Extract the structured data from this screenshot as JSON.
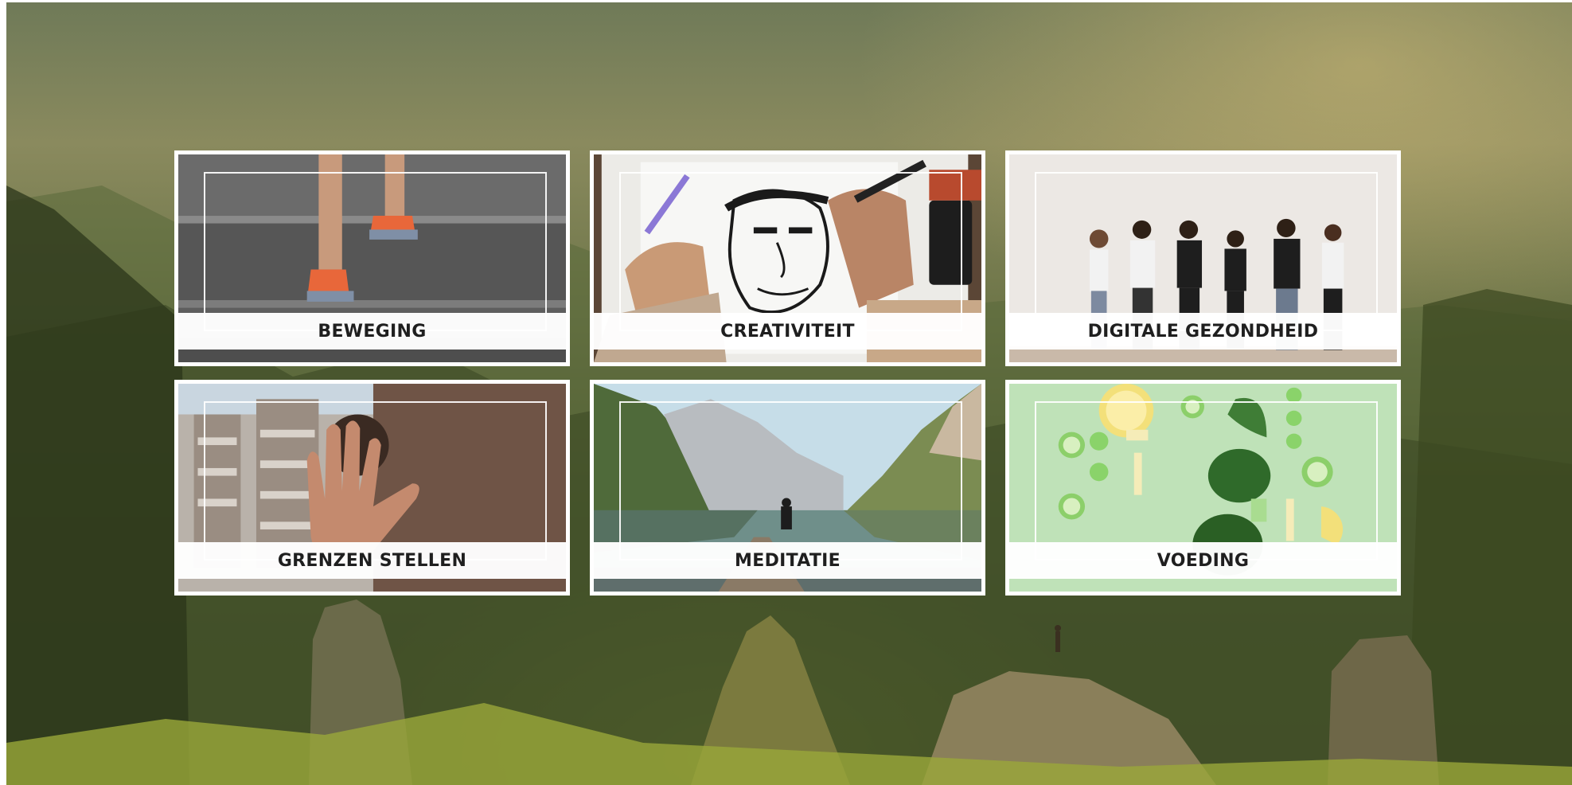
{
  "background": {
    "icon": "mountain-landscape-image",
    "accent": "#3f4a24"
  },
  "tiles": [
    {
      "label": "BEWEGING",
      "icon": "running-shoes-on-stairs-image"
    },
    {
      "label": "CREATIVITEIT",
      "icon": "drawing-sketch-image"
    },
    {
      "label": "DIGITALE GEZONDHEID",
      "icon": "people-with-phones-image"
    },
    {
      "label": "GRENZEN STELLEN",
      "icon": "stop-hand-image"
    },
    {
      "label": "MEDITATIE",
      "icon": "lake-meditation-image"
    },
    {
      "label": "VOEDING",
      "icon": "healthy-vegetables-image"
    }
  ]
}
